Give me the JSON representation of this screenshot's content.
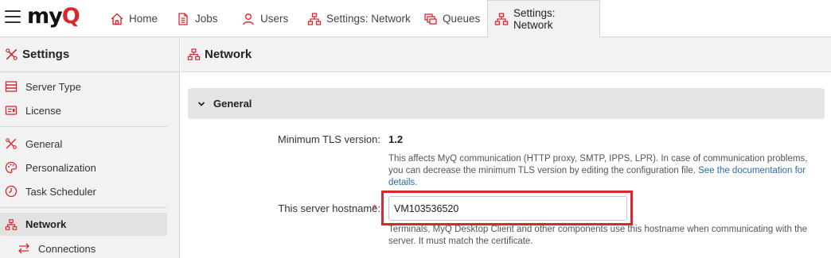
{
  "app": {
    "logo_text_a": "my",
    "logo_text_b": "Q"
  },
  "tabs": [
    {
      "label": "Home",
      "icon": "home-icon"
    },
    {
      "label": "Jobs",
      "icon": "document-icon"
    },
    {
      "label": "Users",
      "icon": "user-icon"
    },
    {
      "label": "Settings: Network",
      "icon": "network-icon"
    },
    {
      "label": "Queues",
      "icon": "queues-icon"
    },
    {
      "label": "Settings: Network",
      "icon": "network-icon",
      "active": true
    }
  ],
  "sidebar": {
    "title": "Settings",
    "items": [
      {
        "label": "Server Type",
        "icon": "server-icon"
      },
      {
        "label": "License",
        "icon": "license-icon"
      },
      {
        "label": "General",
        "icon": "tools-icon"
      },
      {
        "label": "Personalization",
        "icon": "palette-icon"
      },
      {
        "label": "Task Scheduler",
        "icon": "clock-icon"
      },
      {
        "label": "Network",
        "icon": "network-icon",
        "active": true
      },
      {
        "label": "Connections",
        "icon": "arrows-icon"
      }
    ]
  },
  "main": {
    "title": "Network",
    "section_title": "General",
    "tls_label": "Minimum TLS version:",
    "tls_value": "1.2",
    "tls_help": "This affects MyQ communication (HTTP proxy, SMTP, IPPS, LPR). In case of communication problems, you can decrease the minimum TLS version by editing the configuration file. ",
    "tls_help_link": "See the documentation for details",
    "tls_help_end": ".",
    "hostname_label": "This server hostname:",
    "hostname_required": "*",
    "hostname_value": "VM103536520",
    "hostname_help": "Terminals, MyQ Desktop Client and other components use this hostname when communicating with the server. It must match the certificate."
  },
  "colors": {
    "accent": "#d8272d",
    "link": "#2b6aa6",
    "panel": "#f2f2f2"
  }
}
